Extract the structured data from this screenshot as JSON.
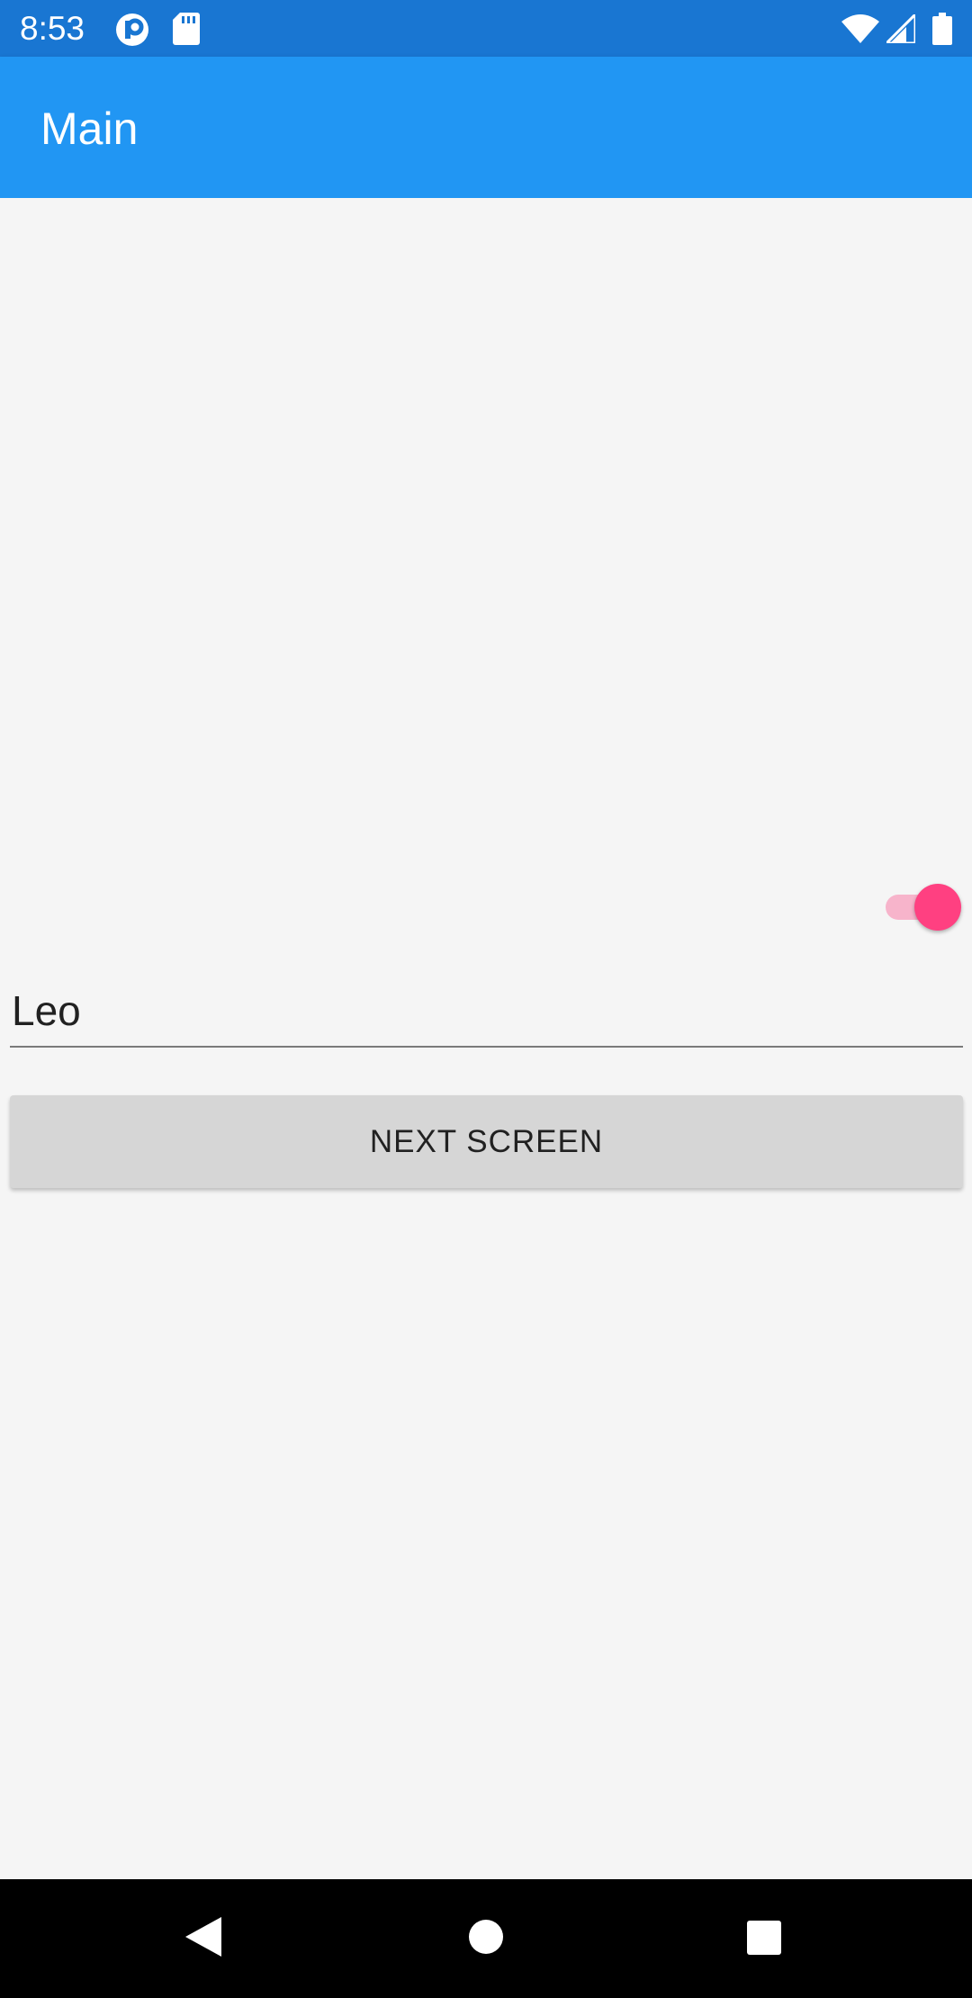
{
  "status_bar": {
    "time": "8:53",
    "left_icons": [
      "notification-app-icon",
      "sd-card-icon"
    ],
    "right_icons": [
      "wifi-icon",
      "cell-signal-icon",
      "battery-icon"
    ]
  },
  "app_bar": {
    "title": "Main",
    "color": "#2196f3"
  },
  "form": {
    "toggle": {
      "state": "on",
      "accent_color": "#ff4081"
    },
    "name_input": {
      "value": "Leo"
    },
    "next_button": {
      "label": "NEXT SCREEN"
    }
  },
  "nav_bar": {
    "buttons": [
      "back-icon",
      "home-icon",
      "recents-icon"
    ]
  }
}
